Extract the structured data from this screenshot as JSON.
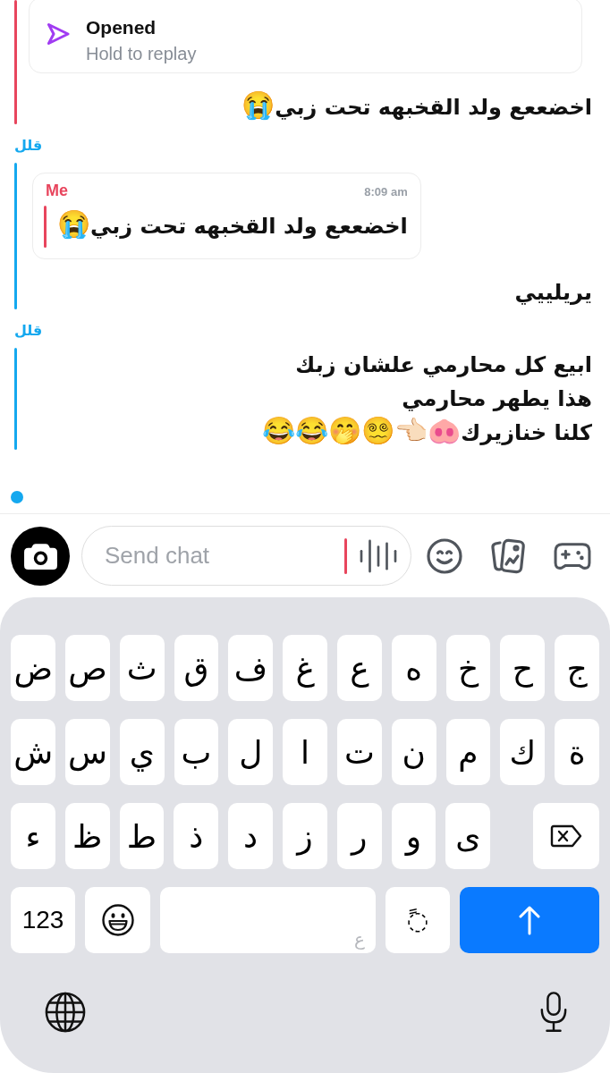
{
  "chat": {
    "groups": [
      {
        "color": "#e8455d",
        "items": [
          {
            "kind": "snap",
            "title": "Opened",
            "hint": "Hold to replay"
          },
          {
            "kind": "text",
            "text": "اخضععع ولد القخبهه تحت زبي😭"
          }
        ]
      },
      {
        "sender": "قلل",
        "color": "#14a8ef",
        "items": [
          {
            "kind": "reply",
            "author": "Me",
            "time": "8:09 am",
            "color": "#e8455d",
            "quote": "اخضععع ولد القخبهه تحت زبي😭"
          },
          {
            "kind": "text",
            "text": "يريلييي"
          }
        ]
      },
      {
        "sender": "قلل",
        "color": "#14a8ef",
        "items": [
          {
            "kind": "text",
            "text": "ابيع كل محارمي علشان زبك\nهذا يطهر محارمي\nكلنا خنازيرك🐽👈🏻😵‍💫🤭😂😂"
          }
        ]
      }
    ],
    "friend_in_chat": true
  },
  "composer": {
    "placeholder": "Send chat",
    "focused": true
  },
  "keyboard": {
    "letter_rows": [
      [
        {
          "kind": "letter",
          "label": "ج"
        },
        {
          "kind": "letter",
          "label": "ح"
        },
        {
          "kind": "letter",
          "label": "خ"
        },
        {
          "kind": "letter",
          "label": "ه"
        },
        {
          "kind": "letter",
          "label": "ع"
        },
        {
          "kind": "letter",
          "label": "غ"
        },
        {
          "kind": "letter",
          "label": "ف"
        },
        {
          "kind": "letter",
          "label": "ق"
        },
        {
          "kind": "letter",
          "label": "ث"
        },
        {
          "kind": "letter",
          "label": "ص"
        },
        {
          "kind": "letter",
          "label": "ض"
        }
      ],
      [
        {
          "kind": "letter",
          "label": "ة"
        },
        {
          "kind": "letter",
          "label": "ك"
        },
        {
          "kind": "letter",
          "label": "م"
        },
        {
          "kind": "letter",
          "label": "ن"
        },
        {
          "kind": "letter",
          "label": "ت"
        },
        {
          "kind": "letter",
          "label": "ا"
        },
        {
          "kind": "letter",
          "label": "ل"
        },
        {
          "kind": "letter",
          "label": "ب"
        },
        {
          "kind": "letter",
          "label": "ي"
        },
        {
          "kind": "letter",
          "label": "س"
        },
        {
          "kind": "letter",
          "label": "ش"
        }
      ],
      [
        {
          "kind": "backspace"
        },
        {
          "kind": "gap"
        },
        {
          "kind": "letter",
          "label": "ى"
        },
        {
          "kind": "letter",
          "label": "و"
        },
        {
          "kind": "letter",
          "label": "ر"
        },
        {
          "kind": "letter",
          "label": "ز"
        },
        {
          "kind": "letter",
          "label": "د"
        },
        {
          "kind": "letter",
          "label": "ذ"
        },
        {
          "kind": "letter",
          "label": "ط"
        },
        {
          "kind": "letter",
          "label": "ظ"
        },
        {
          "kind": "letter",
          "label": "ء"
        }
      ]
    ],
    "bottom_row": [
      {
        "kind": "return"
      },
      {
        "kind": "diacritic",
        "label": "◌ً"
      },
      {
        "kind": "space",
        "hint": "ع"
      },
      {
        "kind": "emoji"
      },
      {
        "kind": "numbers",
        "label": "123"
      }
    ]
  }
}
